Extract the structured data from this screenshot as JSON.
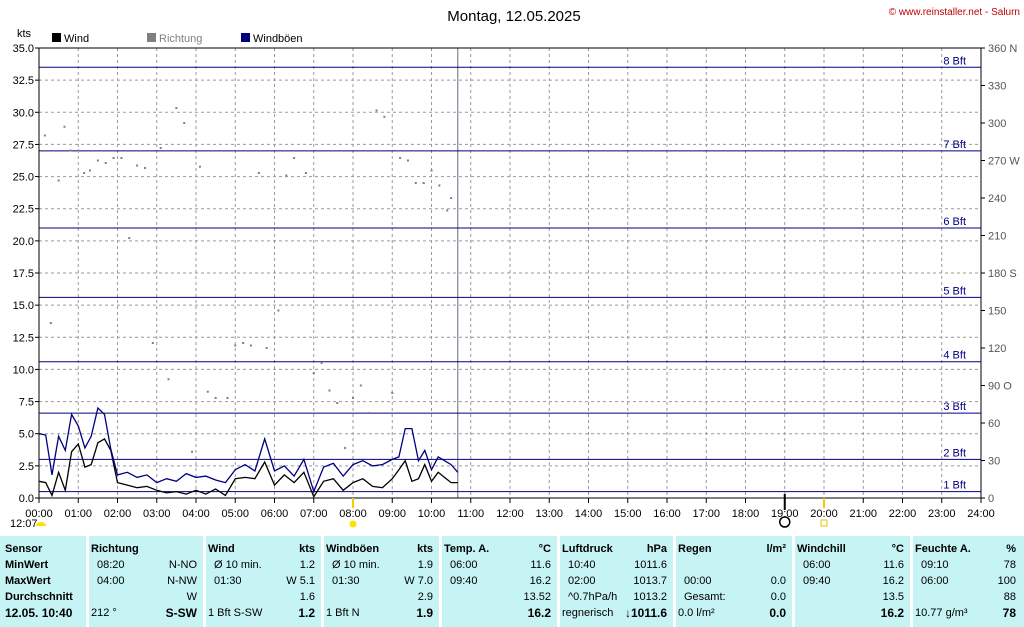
{
  "title": "Montag, 12.05.2025",
  "copyright": "© www.reinstaller.net - Salurn",
  "y_unit_left": "kts",
  "y_unit_right_label": "W",
  "legend": [
    {
      "label": "Wind",
      "color": "#000000"
    },
    {
      "label": "Richtung",
      "color": "#808080"
    },
    {
      "label": "Windböen",
      "color": "#000080"
    }
  ],
  "now_label": "12:07",
  "chart_data": {
    "type": "line",
    "x_ticks": [
      "00:00",
      "01:00",
      "02:00",
      "03:00",
      "04:00",
      "05:00",
      "06:00",
      "07:00",
      "08:00",
      "09:00",
      "10:00",
      "11:00",
      "12:00",
      "13:00",
      "14:00",
      "15:00",
      "16:00",
      "17:00",
      "18:00",
      "19:00",
      "20:00",
      "21:00",
      "22:00",
      "23:00",
      "24:00"
    ],
    "xlim": [
      0,
      24
    ],
    "ylim": [
      0,
      35
    ],
    "y_ticks": [
      "0.0",
      "2.5",
      "5.0",
      "7.5",
      "10.0",
      "12.5",
      "15.0",
      "17.5",
      "20.0",
      "22.5",
      "25.0",
      "27.5",
      "30.0",
      "32.5",
      "35.0"
    ],
    "y2lim": [
      0,
      360
    ],
    "y2_ticks": [
      "0",
      "30",
      "60",
      "90",
      "120",
      "150",
      "180",
      "210",
      "240",
      "270",
      "300",
      "330",
      "360"
    ],
    "y2_tick_labels": [
      "0",
      "30",
      "60",
      "90 O",
      "120",
      "150",
      "180 S",
      "210",
      "240",
      "270 W",
      "300",
      "330",
      "360 N"
    ],
    "beaufort_lines": [
      {
        "label": "1 Bft",
        "value": 0.5
      },
      {
        "label": "2 Bft",
        "value": 3.0
      },
      {
        "label": "3 Bft",
        "value": 6.6
      },
      {
        "label": "4 Bft",
        "value": 10.6
      },
      {
        "label": "5 Bft",
        "value": 15.6
      },
      {
        "label": "6 Bft",
        "value": 21.0
      },
      {
        "label": "7 Bft",
        "value": 27.0
      },
      {
        "label": "8 Bft",
        "value": 33.5
      }
    ],
    "current_time": 10.67,
    "sunrise": 8.0,
    "sunset": 20.0,
    "moon": 19.0,
    "series": [
      {
        "name": "Wind",
        "color": "#000000",
        "type": "line",
        "x": [
          0,
          0.17,
          0.33,
          0.5,
          0.67,
          0.83,
          1.0,
          1.17,
          1.33,
          1.5,
          1.67,
          1.83,
          2.0,
          2.25,
          2.5,
          2.75,
          3.0,
          3.25,
          3.5,
          3.75,
          4.0,
          4.25,
          4.5,
          4.75,
          5.0,
          5.25,
          5.5,
          5.75,
          6.0,
          6.25,
          6.5,
          6.75,
          7.0,
          7.25,
          7.5,
          7.75,
          8.0,
          8.25,
          8.5,
          8.75,
          9.0,
          9.17,
          9.33,
          9.5,
          9.67,
          9.83,
          10.0,
          10.17,
          10.33,
          10.5,
          10.67
        ],
        "y": [
          1.3,
          1.2,
          0.2,
          2.0,
          0.6,
          3.6,
          4.2,
          2.4,
          2.6,
          4.3,
          4.6,
          3.7,
          1.2,
          1.0,
          0.8,
          0.9,
          0.6,
          0.4,
          0.5,
          0.3,
          0.6,
          0.3,
          0.7,
          0.2,
          1.5,
          1.6,
          1.5,
          2.8,
          1.0,
          1.8,
          1.2,
          2.0,
          0.1,
          1.3,
          1.5,
          0.6,
          1.2,
          1.5,
          0.9,
          0.8,
          1.5,
          2.2,
          2.9,
          1.3,
          1.5,
          2.6,
          1.3,
          2.0,
          1.6,
          1.2,
          1.2
        ]
      },
      {
        "name": "Windböen",
        "color": "#000080",
        "type": "line",
        "x": [
          0,
          0.17,
          0.33,
          0.5,
          0.67,
          0.83,
          1.0,
          1.17,
          1.33,
          1.5,
          1.67,
          1.83,
          2.0,
          2.25,
          2.5,
          2.75,
          3.0,
          3.25,
          3.5,
          3.75,
          4.0,
          4.25,
          4.5,
          4.75,
          5.0,
          5.25,
          5.5,
          5.75,
          6.0,
          6.25,
          6.5,
          6.75,
          7.0,
          7.25,
          7.5,
          7.75,
          8.0,
          8.25,
          8.5,
          8.75,
          9.0,
          9.17,
          9.33,
          9.5,
          9.67,
          9.83,
          10.0,
          10.17,
          10.33,
          10.5,
          10.67
        ],
        "y": [
          5.0,
          4.9,
          1.8,
          4.8,
          3.7,
          6.5,
          5.6,
          3.9,
          4.8,
          7.0,
          6.5,
          3.8,
          1.8,
          2.0,
          1.6,
          1.8,
          1.2,
          1.5,
          1.3,
          1.9,
          1.6,
          1.7,
          1.4,
          1.2,
          2.2,
          2.6,
          2.1,
          4.6,
          2.1,
          2.5,
          1.7,
          3.0,
          0.5,
          2.4,
          2.7,
          1.7,
          2.6,
          2.9,
          2.5,
          2.6,
          3.0,
          3.2,
          5.4,
          5.4,
          2.9,
          3.7,
          2.2,
          3.2,
          2.9,
          2.6,
          2.0
        ]
      },
      {
        "name": "Richtung",
        "color": "#808080",
        "type": "scatter",
        "axis": "right",
        "x": [
          0.15,
          0.3,
          0.5,
          0.65,
          0.8,
          1.0,
          1.15,
          1.3,
          1.5,
          1.7,
          1.9,
          2.1,
          2.3,
          2.5,
          2.7,
          2.9,
          3.1,
          3.3,
          3.5,
          3.7,
          3.9,
          4.1,
          4.3,
          4.5,
          4.8,
          5.0,
          5.2,
          5.4,
          5.6,
          5.8,
          6.1,
          6.3,
          6.5,
          6.8,
          7.0,
          7.2,
          7.4,
          7.6,
          7.8,
          8.0,
          8.2,
          8.4,
          8.6,
          8.8,
          9.0,
          9.2,
          9.4,
          9.6,
          9.8,
          10.0,
          10.2,
          10.4,
          10.5
        ],
        "y": [
          290,
          140,
          254,
          297,
          278,
          278,
          260,
          262,
          270,
          268,
          272,
          272,
          208,
          266,
          264,
          124,
          280,
          95,
          312,
          300,
          37,
          265,
          85,
          80,
          80,
          122,
          124,
          122,
          260,
          120,
          150,
          258,
          272,
          260,
          100,
          108,
          86,
          76,
          40,
          80,
          90,
          68,
          310,
          305,
          84,
          272,
          270,
          252,
          252,
          262,
          250,
          230,
          240
        ]
      }
    ]
  },
  "table": {
    "columns": [
      {
        "h1": "Sensor",
        "h2": "",
        "rows": [
          [
            "MinWert",
            ""
          ],
          [
            "MaxWert",
            ""
          ],
          [
            "Durchschnitt",
            ""
          ]
        ],
        "footer": [
          "12.05. 10:40",
          ""
        ]
      },
      {
        "h1": "Richtung",
        "h2": "",
        "rows": [
          [
            "08:20",
            "N-NO"
          ],
          [
            "04:00",
            "N-NW"
          ],
          [
            "",
            "W"
          ]
        ],
        "footer": [
          "212 °",
          "S-SW"
        ]
      },
      {
        "h1": "Wind",
        "h2": "kts",
        "rows": [
          [
            "Ø 10 min.",
            "1.2"
          ],
          [
            "01:30",
            "W 5.1"
          ],
          [
            "",
            "1.6"
          ]
        ],
        "footer": [
          "1 Bft S-SW",
          "1.2"
        ]
      },
      {
        "h1": "Windböen",
        "h2": "kts",
        "rows": [
          [
            "Ø 10 min.",
            "1.9"
          ],
          [
            "01:30",
            "W 7.0"
          ],
          [
            "",
            "2.9"
          ]
        ],
        "footer": [
          "1 Bft N",
          "1.9"
        ]
      },
      {
        "h1": "Temp. A.",
        "h2": "°C",
        "rows": [
          [
            "06:00",
            "11.6"
          ],
          [
            "09:40",
            "16.2"
          ],
          [
            "",
            "13.52"
          ]
        ],
        "footer": [
          "",
          "16.2"
        ]
      },
      {
        "h1": "Luftdruck",
        "h2": "hPa",
        "rows": [
          [
            "10:40",
            "1011.6"
          ],
          [
            "02:00",
            "1013.7"
          ],
          [
            "^0.7hPa/h",
            "1013.2"
          ]
        ],
        "footer": [
          "regnerisch",
          "↓1011.6"
        ]
      },
      {
        "h1": "Regen",
        "h2": "l/m²",
        "rows": [
          [
            "",
            ""
          ],
          [
            "00:00",
            "0.0"
          ],
          [
            "Gesamt:",
            "0.0"
          ]
        ],
        "footer": [
          "0.0 l/m²",
          "0.0"
        ]
      },
      {
        "h1": "Windchill",
        "h2": "°C",
        "rows": [
          [
            "06:00",
            "11.6"
          ],
          [
            "09:40",
            "16.2"
          ],
          [
            "",
            "13.5"
          ]
        ],
        "footer": [
          "",
          "16.2"
        ]
      },
      {
        "h1": "Feuchte A.",
        "h2": "%",
        "rows": [
          [
            "09:10",
            "78"
          ],
          [
            "06:00",
            "100"
          ],
          [
            "",
            "88"
          ]
        ],
        "footer": [
          "10.77 g/m³",
          "78"
        ]
      }
    ]
  }
}
